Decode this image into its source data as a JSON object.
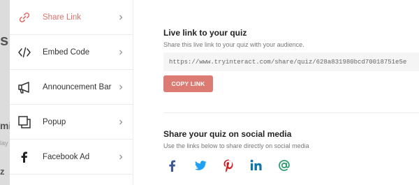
{
  "background": {
    "top_letter": "s",
    "mid_letter": "mi",
    "mid_faint": "lay",
    "bottom_letter": "z"
  },
  "sidebar": {
    "items": [
      {
        "label": "Share Link",
        "icon": "link-icon",
        "active": true
      },
      {
        "label": "Embed Code",
        "icon": "code-icon",
        "active": false
      },
      {
        "label": "Announcement Bar",
        "icon": "megaphone-icon",
        "active": false
      },
      {
        "label": "Popup",
        "icon": "popup-icon",
        "active": false
      },
      {
        "label": "Facebook Ad",
        "icon": "facebook-icon",
        "active": false
      }
    ]
  },
  "live_link": {
    "title": "Live link to your quiz",
    "subtitle": "Share this live link to your quiz with your audience.",
    "url": "https://www.tryinteract.com/share/quiz/628a831980bcd70018751e5e",
    "copy_label": "COPY LINK"
  },
  "social": {
    "title": "Share your quiz on social media",
    "subtitle": "Use the links below to share directly on social media",
    "icons": [
      "facebook-share-icon",
      "twitter-share-icon",
      "pinterest-share-icon",
      "linkedin-share-icon",
      "email-share-icon"
    ]
  },
  "colors": {
    "accent": "#dc7b73",
    "facebook": "#3b5998",
    "twitter": "#1da1f2",
    "pinterest": "#cb2027",
    "linkedin": "#0e76a8",
    "email": "#2e9e6e"
  }
}
